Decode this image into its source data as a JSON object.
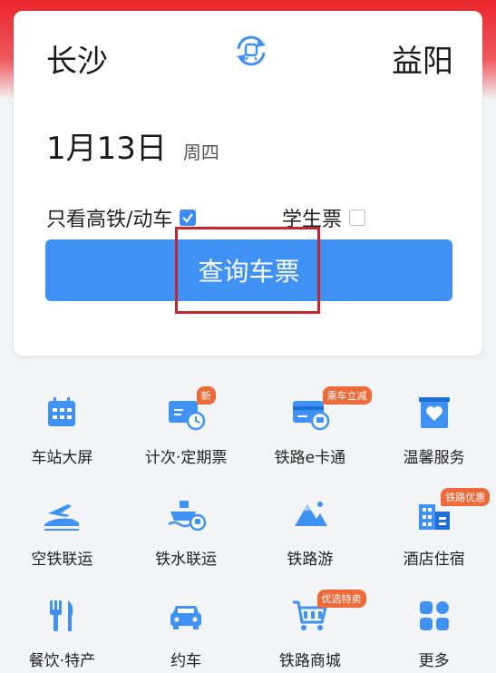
{
  "search": {
    "from_city": "长沙",
    "to_city": "益阳",
    "date": "1月13日",
    "weekday": "周四",
    "high_speed_label": "只看高铁/动车",
    "high_speed_checked": true,
    "student_label": "学生票",
    "student_checked": false,
    "button_label": "查询车票"
  },
  "services": [
    {
      "label": "车站大屏",
      "icon": "calendar-icon"
    },
    {
      "label": "计次·定期票",
      "icon": "ticket-card-icon",
      "badge": "新"
    },
    {
      "label": "铁路e卡通",
      "icon": "e-card-icon",
      "badge": "乘车立减"
    },
    {
      "label": "温馨服务",
      "icon": "heart-service-icon"
    },
    {
      "label": "空铁联运",
      "icon": "plane-train-icon"
    },
    {
      "label": "铁水联运",
      "icon": "ship-train-icon"
    },
    {
      "label": "铁路游",
      "icon": "mountain-icon"
    },
    {
      "label": "酒店住宿",
      "icon": "hotel-icon",
      "badge": "铁路优惠"
    },
    {
      "label": "餐饮·特产",
      "icon": "fork-knife-icon"
    },
    {
      "label": "约车",
      "icon": "car-icon"
    },
    {
      "label": "铁路商城",
      "icon": "cart-icon",
      "badge": "优选特卖"
    },
    {
      "label": "更多",
      "icon": "more-grid-icon"
    }
  ],
  "colors": {
    "accent": "#3f92f4",
    "badge": "#ef6a3a",
    "header_red": "#e8262b",
    "highlight": "#c1272d"
  }
}
